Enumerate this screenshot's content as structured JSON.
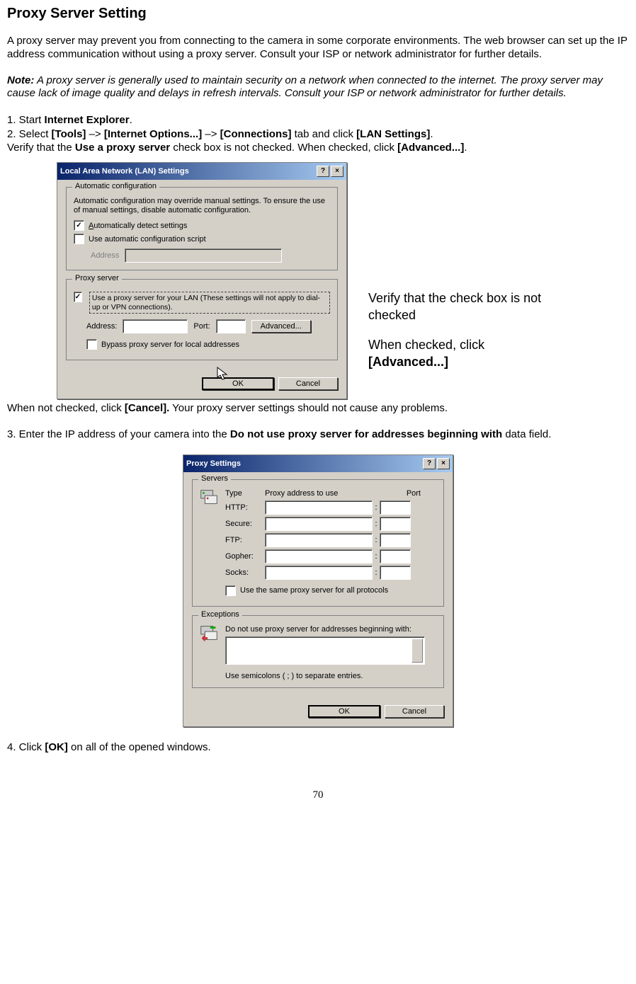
{
  "heading": "Proxy Server Setting",
  "intro": "A proxy server may prevent you from connecting to the camera in some corporate environments. The web browser can set up the IP address communication without using a proxy server. Consult your ISP or network administrator for further details.",
  "note_label": "Note:",
  "note_body": " A proxy server is generally used to maintain security on a network when connected to the internet. The proxy server may cause lack of image quality and delays in refresh intervals. Consult your ISP or network administrator for further details.",
  "step1_pre": "1. Start ",
  "step1_bold": "Internet Explorer",
  "step1_post": ".",
  "step2_a": "2. Select ",
  "step2_b1": "[Tools]",
  "step2_c1": " –> ",
  "step2_b2": "[Internet Options...]",
  "step2_c2": " –> ",
  "step2_b3": "[Connections]",
  "step2_c3": " tab and click ",
  "step2_b4": "[LAN Settings]",
  "step2_c4": ".",
  "step2v_a": "Verify that the ",
  "step2v_b": "Use a proxy server",
  "step2v_c": " check box is not checked. When checked, click ",
  "step2v_d": "[Advanced...]",
  "step2v_e": ".",
  "dlg1": {
    "title": "Local Area Network (LAN) Settings",
    "help_btn": "?",
    "close_btn": "×",
    "group_auto": "Automatic configuration",
    "auto_text": "Automatic configuration may override manual settings.  To ensure the use of manual settings, disable automatic configuration.",
    "chk_autodetect": "Automatically detect settings",
    "chk_autoscript": "Use automatic configuration script",
    "address_label": "Address",
    "group_proxy": "Proxy server",
    "proxy_desc": "Use a proxy server for your LAN (These settings will not apply to dial-up or VPN connections).",
    "addr2": "Address:",
    "port": "Port:",
    "advanced": "Advanced...",
    "bypass": "Bypass proxy server for local addresses",
    "ok": "OK",
    "cancel": "Cancel"
  },
  "callout1": "Verify that the check box is not checked",
  "callout2_a": "When checked, click",
  "callout2_b": "[Advanced...]",
  "after1_a": "When not checked, click ",
  "after1_b": "[Cancel].",
  "after1_c": " Your proxy server settings should not cause any problems.",
  "step3_a": "3. Enter the IP address of your camera into the ",
  "step3_b": "Do not use proxy server for addresses beginning with",
  "step3_c": " data field.",
  "dlg2": {
    "title": "Proxy Settings",
    "help_btn": "?",
    "close_btn": "×",
    "group_servers": "Servers",
    "head_type": "Type",
    "head_addr": "Proxy address to use",
    "head_port": "Port",
    "rows": [
      "HTTP:",
      "Secure:",
      "FTP:",
      "Gopher:",
      "Socks:"
    ],
    "same": "Use the same proxy server for all protocols",
    "group_exc": "Exceptions",
    "exc_label": "Do not use proxy server for addresses beginning with:",
    "exc_note": "Use semicolons ( ; ) to separate entries.",
    "ok": "OK",
    "cancel": "Cancel"
  },
  "step4_a": "4. Click ",
  "step4_b": "[OK]",
  "step4_c": " on all of the opened windows.",
  "page_number": "70"
}
